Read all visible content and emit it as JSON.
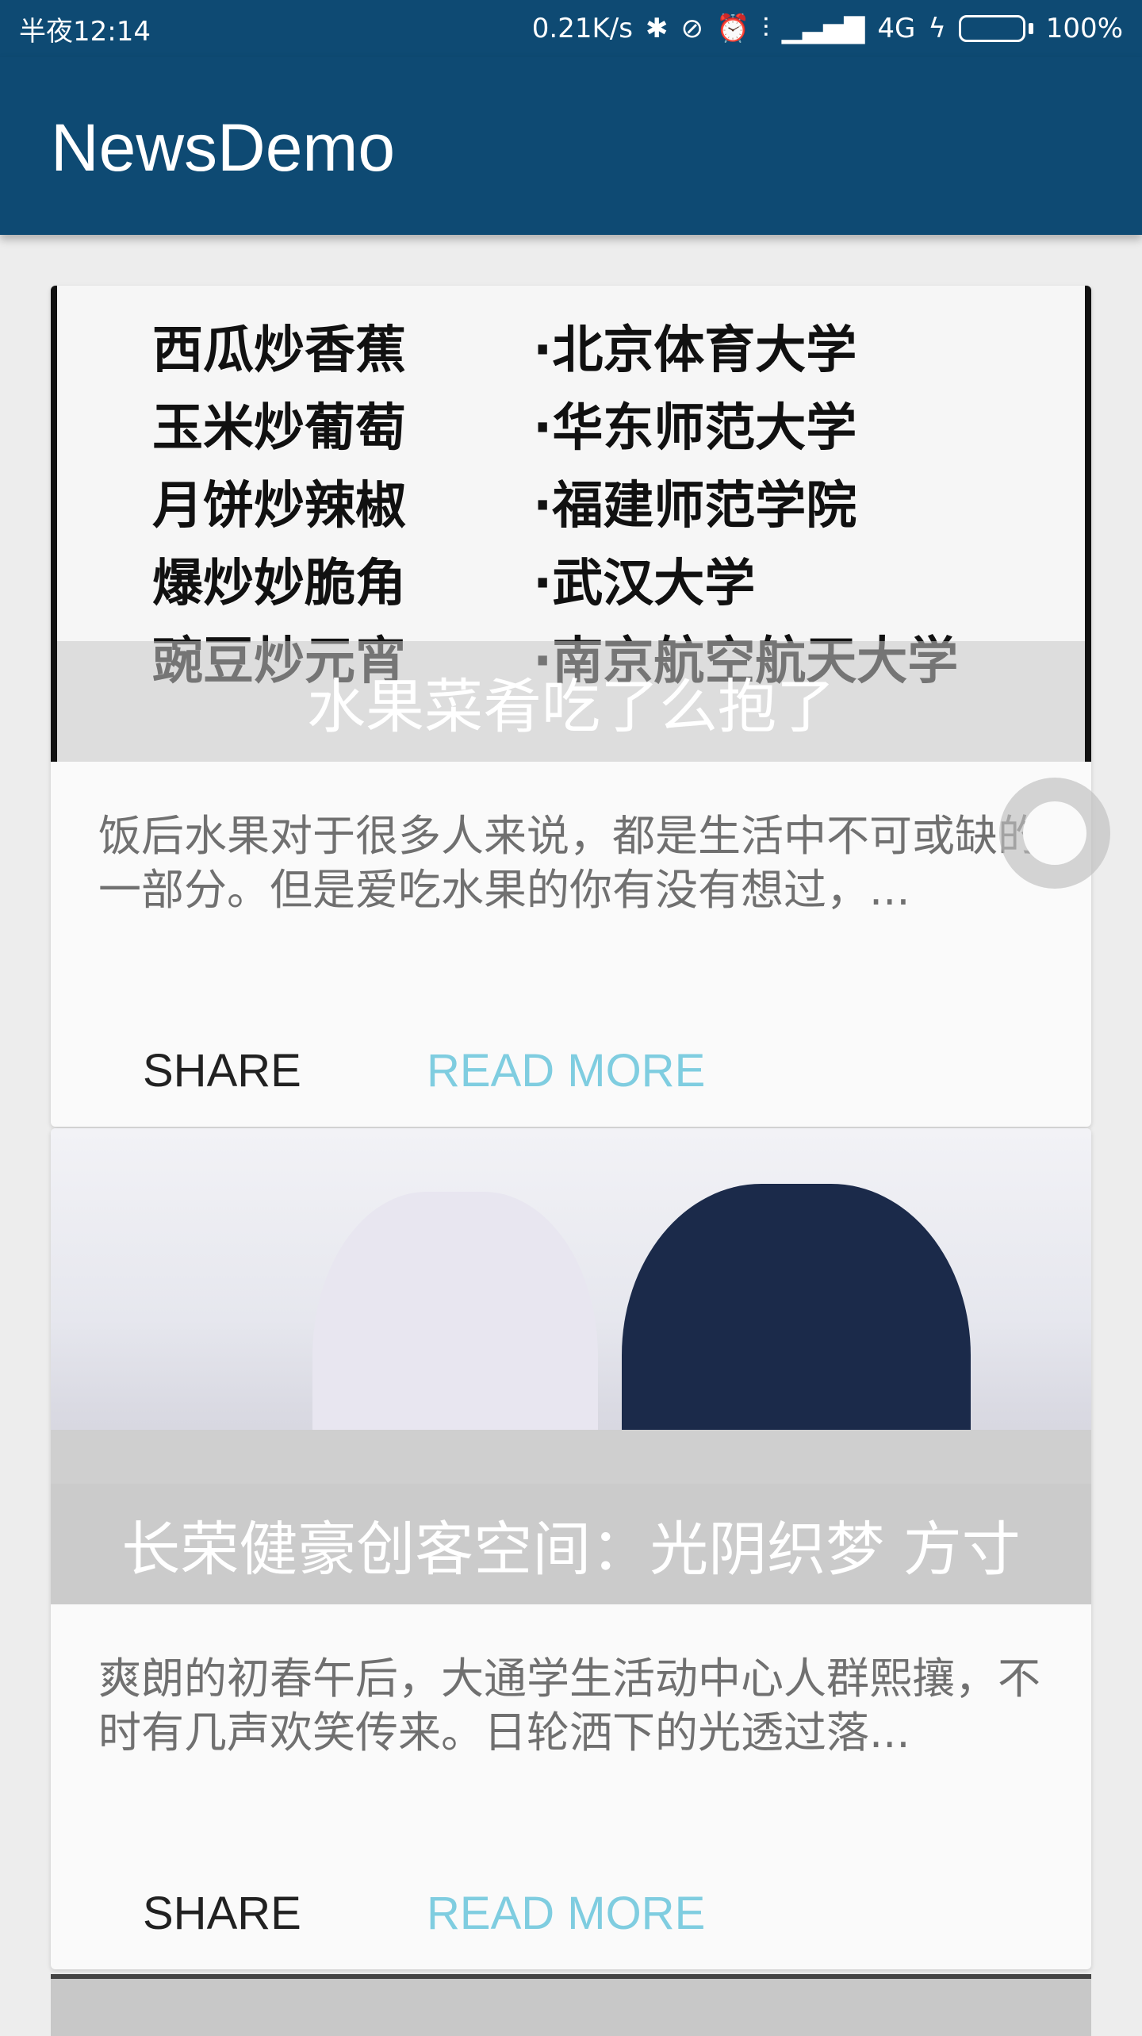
{
  "status_bar": {
    "time": "半夜12:14",
    "speed": "0.21K/s",
    "network": "4G",
    "battery": "100%",
    "battery_level": 100
  },
  "app_bar": {
    "title": "NewsDemo"
  },
  "cards": [
    {
      "title": "水果菜肴吃了么抱了",
      "summary": "饭后水果对于很多人来说，都是生活中不可或缺的一部分。但是爱吃水果的你有没有想过，...",
      "share_label": "SHARE",
      "read_label": "READ MORE",
      "image_rows": [
        {
          "left": "西瓜炒香蕉",
          "right": "·北京体育大学"
        },
        {
          "left": "玉米炒葡萄",
          "right": "·华东师范大学"
        },
        {
          "left": "月饼炒辣椒",
          "right": "·福建师范学院"
        },
        {
          "left": "爆炒妙脆角",
          "right": "·武汉大学"
        },
        {
          "left": "豌豆炒元宵",
          "right": "·南京航空航天大学"
        }
      ]
    },
    {
      "title": "长荣健豪创客空间：光阴织梦 方寸",
      "summary": "爽朗的初春午后，大通学生活动中心人群熙攘，不时有几声欢笑传来。日轮洒下的光透过落...",
      "share_label": "SHARE",
      "read_label": "READ MORE"
    }
  ]
}
